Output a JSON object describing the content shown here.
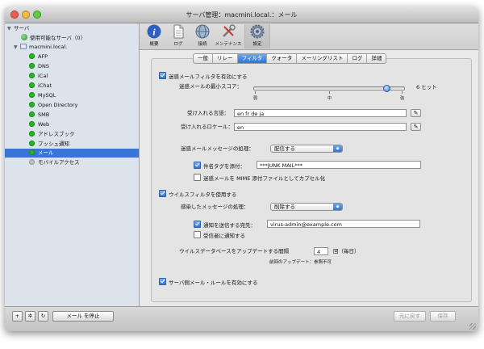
{
  "window": {
    "title": "サーバ管理：macmini.local.：メール"
  },
  "sidebar": {
    "header": "サーバ",
    "available_label": "使用可能なサーバ（0）",
    "host": "macmini.local.",
    "services": [
      "AFP",
      "DNS",
      "iCal",
      "iChat",
      "MySQL",
      "Open Directory",
      "SMB",
      "Web",
      "アドレスブック",
      "プッシュ通知",
      "メール",
      "モバイルアクセス"
    ],
    "selected": "メール"
  },
  "toolbar": {
    "buttons": [
      "概要",
      "ログ",
      "接続",
      "メンテナンス",
      "設定"
    ],
    "selected": "設定"
  },
  "tabs": [
    "一般",
    "リレー",
    "フィルタ",
    "クォータ",
    "メーリングリスト",
    "ログ",
    "詳細"
  ],
  "selected_tab": "フィルタ",
  "filter": {
    "spam_enable": "迷惑メールフィルタを有効にする",
    "min_score_label": "迷惑メールの最小スコア：",
    "min_score_value": "6 ヒット",
    "min_score_level": 0.89,
    "slider_labels": [
      "弱",
      "中",
      "強"
    ],
    "languages_label": "受け入れる言語：",
    "languages_value": "en fr de ja",
    "locales_label": "受け入れるロケール：",
    "locales_value": "en",
    "spam_handling_label": "迷惑メールメッセージの処理：",
    "spam_handling_value": "配信する",
    "tag_subject_label": "件名タグを添付：",
    "tag_subject_value": "***JUNK MAIL***",
    "encapsulate_label": "迷惑メールを MIME 添付ファイルとしてカプセル化",
    "virus_enable": "ウイルスフィルタを使用する",
    "infected_handling_label": "感染したメッセージの処理：",
    "infected_handling_value": "削除する",
    "notify_label": "通知を送信する宛先：",
    "notify_value": "virus-admin@example.com",
    "notify_recipient": "受信者に通知する",
    "update_label": "ウイルスデータベースをアップデートする間隔",
    "update_value": "4",
    "update_unit": "回（毎日）",
    "last_update": "前回のアップデート：参照不可",
    "server_rules": "サーバ側メール・ルールを有効にする"
  },
  "bottom": {
    "add": "+",
    "gear": "✲",
    "refresh": "↻",
    "stop": "メール を停止",
    "revert": "元に戻す",
    "save": "保存"
  }
}
